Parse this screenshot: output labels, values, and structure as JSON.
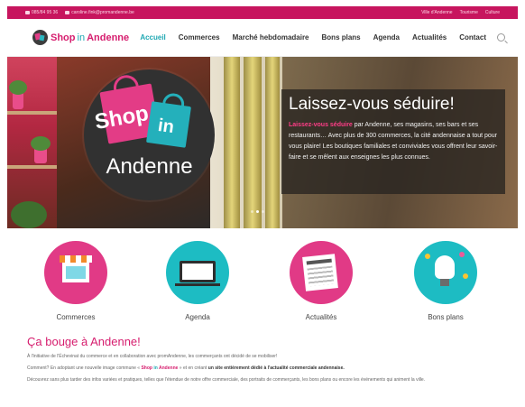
{
  "topbar": {
    "phone": "085/84 95 36",
    "email": "caroline.fink@promandenne.be",
    "links": [
      "Ville d'Andenne",
      "Tourisme",
      "Culture"
    ]
  },
  "header": {
    "logo_shop": "Shop",
    "logo_in": "in",
    "logo_andenne": "Andenne",
    "nav": [
      "Accueil",
      "Commerces",
      "Marché hebdomadaire",
      "Bons plans",
      "Agenda",
      "Actualités",
      "Contact"
    ]
  },
  "hero": {
    "badge_shop": "Shop",
    "badge_in": "in",
    "badge_andenne": "Andenne",
    "title": "Laissez-vous séduire!",
    "text_highlight": "Laissez-vous séduire",
    "text_rest": " par Andenne, ses magasins, ses bars et ses restaurants… Avec plus de 300 commerces, la cité andennaise a tout pour vous plaire! Les boutiques familiales et conviviales vous offrent leur savoir-faire et se mêlent aux enseignes les plus connues."
  },
  "features": [
    {
      "label": "Commerces",
      "color": "#e13a86"
    },
    {
      "label": "Agenda",
      "color": "#1dbcc3"
    },
    {
      "label": "Actualités",
      "color": "#e13a86"
    },
    {
      "label": "Bons plans",
      "color": "#1dbcc3"
    }
  ],
  "content": {
    "heading": "Ça bouge à Andenne!",
    "p1": "À l'initiative de l'Échevinat du commerce et en collaboration avec promAndenne, les commerçants ont décidé de se mobiliser!",
    "p2_a": "Comment? En adoptant une nouvelle image commune « ",
    "p2_shop": "Shop",
    "p2_in": " in ",
    "p2_andenne": "Andenne",
    "p2_b": " » et en créant ",
    "p2_bold": "un site entièrement dédié à l'actualité commerciale andennaise.",
    "p3": "Découvrez sans plus tarder des infos variées et pratiques, telles que l'étendue de notre offre commerciale, des portraits de commerçants, les bons plans ou encore les événements qui animent la ville."
  },
  "colors": {
    "brand_pink": "#d61d6e",
    "brand_teal": "#1fa8b3",
    "topbar": "#c7155e"
  }
}
